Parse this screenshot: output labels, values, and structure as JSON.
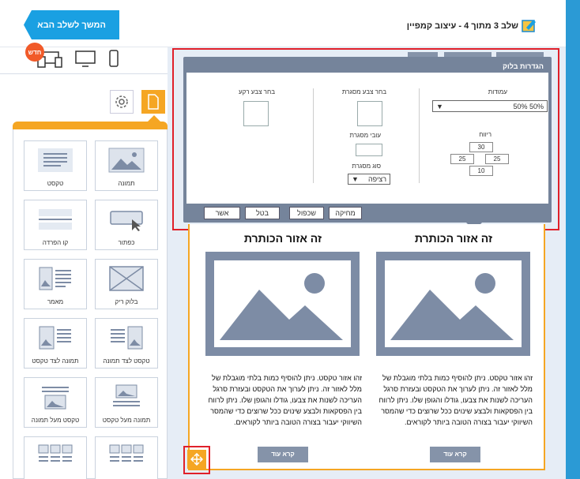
{
  "header": {
    "next_button": "המשך לשלב הבא",
    "step_text": "שלב 3 מתוך 4 - עיצוב קמפיין"
  },
  "devices": {
    "new_badge": "חדש"
  },
  "palette": {
    "items": [
      {
        "label": "תמונה",
        "icon": "image-icon"
      },
      {
        "label": "טקסט",
        "icon": "text-icon"
      },
      {
        "label": "כפתור",
        "icon": "button-icon"
      },
      {
        "label": "קו הפרדה",
        "icon": "divider-icon"
      },
      {
        "label": "בלוק ריק",
        "icon": "empty-block-icon"
      },
      {
        "label": "מאמר",
        "icon": "article-icon"
      },
      {
        "label": "טקסט לצד תמונה",
        "icon": "text-beside-image-icon"
      },
      {
        "label": "תמונה לצד טקסט",
        "icon": "image-beside-text-icon"
      },
      {
        "label": "תמונה מעל טקסט",
        "icon": "image-above-text-icon"
      },
      {
        "label": "טקסט מעל תמונה",
        "icon": "text-above-image-icon"
      }
    ]
  },
  "settings": {
    "title": "הגדרות בלוק",
    "columns_label": "עמודות",
    "columns_value": "50% 50%",
    "spacing_label": "ריווח",
    "spacing": {
      "top": "30",
      "right": "25",
      "left": "25",
      "bottom": "10"
    },
    "border_color_label": "בחר צבע מסגרת",
    "border_width_label": "עובי מסגרת",
    "border_type_label": "סוג מסגרת",
    "border_type_value": "רציפה",
    "bg_color_label": "בחר צבע רקע",
    "buttons": {
      "delete": "מחיקה",
      "duplicate": "שכפול",
      "cancel": "בטל",
      "confirm": "אשר"
    }
  },
  "content": {
    "columns": [
      {
        "title": "זה אזור הכותרת",
        "text": "זהו אזור טקסט. ניתן להוסיף כמות בלתי מוגבלת של מלל לאזור זה. ניתן לערוך את הטקסט ובעזרת סרגל העריכה לשנות את צבעו, גודלו והגופן שלו. ניתן לרווח בין הפסקאות ולבצע שינוים ככל שרוצים כדי שהמסר השיווקי יעבור בצורה הטובה ביותר לקוראים.",
        "button": "קרא עוד"
      },
      {
        "title": "זה אזור הכותרת",
        "text": "זהו אזור טקסט. ניתן להוסיף כמות בלתי מוגבלת של מלל לאזור זה. ניתן לערוך את הטקסט ובעזרת סרגל העריכה לשנות את צבעו, גודלו והגופן שלו. ניתן לרווח בין הפסקאות ולבצע שינוים ככל שרוצים כדי שהמסר השיווקי יעבור בצורה הטובה ביותר לקוראים.",
        "button": "קרא עוד"
      }
    ]
  },
  "colors": {
    "accent": "#f5a623",
    "primary": "#1aa0e2",
    "panel": "#75849b",
    "highlight": "#e0202a"
  }
}
